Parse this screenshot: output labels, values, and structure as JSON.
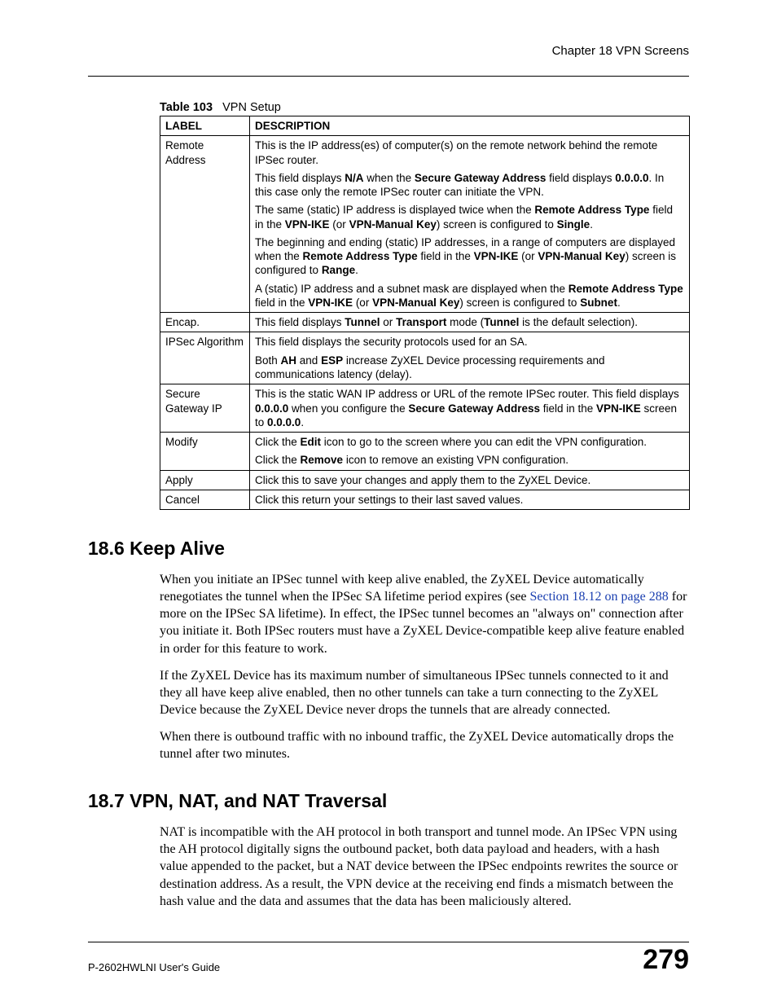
{
  "running_head": "Chapter 18 VPN Screens",
  "table": {
    "caption_num": "Table 103",
    "caption_title": "VPN Setup",
    "head_label": "LABEL",
    "head_desc": "DESCRIPTION",
    "rows": {
      "remote_address": {
        "label": "Remote Address",
        "p1a": "This is the IP address(es) of computer(s) on the remote network behind the remote IPSec router.",
        "p2a": "This field displays ",
        "p2b": "N/A",
        "p2c": " when the ",
        "p2d": "Secure Gateway Address",
        "p2e": " field displays ",
        "p2f": "0.0.0.0",
        "p2g": ". In this case only the remote IPSec router can initiate the VPN.",
        "p3a": "The same (static) IP address is displayed twice when the ",
        "p3b": "Remote Address Type",
        "p3c": " field in the ",
        "p3d": "VPN-IKE",
        "p3e": " (or ",
        "p3f": "VPN-Manual Key",
        "p3g": ") screen is configured to ",
        "p3h": "Single",
        "p3i": ".",
        "p4a": "The beginning and ending (static) IP addresses, in a range of computers are displayed when the ",
        "p4b": "Remote Address Type",
        "p4c": " field in the ",
        "p4d": "VPN-IKE",
        "p4e": " (or ",
        "p4f": "VPN-Manual Key",
        "p4g": ") screen is configured to ",
        "p4h": "Range",
        "p4i": ".",
        "p5a": "A (static) IP address and a subnet mask are displayed when the ",
        "p5b": "Remote Address Type",
        "p5c": " field in the ",
        "p5d": "VPN-IKE",
        "p5e": " (or ",
        "p5f": "VPN-Manual Key",
        "p5g": ") screen is configured to ",
        "p5h": "Subnet",
        "p5i": "."
      },
      "encap": {
        "label": "Encap.",
        "a": "This field displays ",
        "b": "Tunnel",
        "c": " or ",
        "d": "Transport",
        "e": " mode (",
        "f": "Tunnel",
        "g": " is the default selection)."
      },
      "ipsec_alg": {
        "label": "IPSec Algorithm",
        "p1": "This field displays the security protocols used for an SA.",
        "p2a": "Both ",
        "p2b": "AH",
        "p2c": " and ",
        "p2d": "ESP",
        "p2e": " increase ZyXEL Device processing requirements and communications latency (delay)."
      },
      "secure_gw": {
        "label": "Secure Gateway IP",
        "a": "This is the static WAN IP address or URL of the remote IPSec router. This field displays ",
        "b": "0.0.0.0",
        "c": " when you configure the ",
        "d": "Secure Gateway Address",
        "e": " field in the ",
        "f": "VPN-IKE",
        "g": " screen to ",
        "h": "0.0.0.0",
        "i": "."
      },
      "modify": {
        "label": "Modify",
        "p1a": "Click the ",
        "p1b": "Edit",
        "p1c": " icon to go to the screen where you can edit the VPN configuration.",
        "p2a": "Click the ",
        "p2b": "Remove",
        "p2c": " icon to remove an existing VPN configuration."
      },
      "apply": {
        "label": "Apply",
        "a": "Click this to save your changes and apply them to the ZyXEL Device."
      },
      "cancel": {
        "label": "Cancel",
        "a": "Click this return your settings to their last saved values."
      }
    }
  },
  "sections": {
    "keep_alive": {
      "heading": "18.6  Keep Alive",
      "p1a": "When you initiate an IPSec tunnel with keep alive enabled, the ZyXEL Device automatically renegotiates the tunnel when the IPSec SA lifetime period expires (see ",
      "p1link": "Section 18.12 on page 288",
      "p1b": " for more on the IPSec SA lifetime). In effect, the IPSec tunnel becomes an \"always on\" connection after you initiate it. Both IPSec routers must have a ZyXEL Device-compatible keep alive feature enabled in order for this feature to work.",
      "p2": "If the ZyXEL Device has its maximum number of simultaneous IPSec tunnels connected to it and they all have keep alive enabled, then no other tunnels can take a turn connecting to the ZyXEL Device because the ZyXEL Device never drops the tunnels that are already connected.",
      "p3": "When there is outbound traffic with no inbound traffic, the ZyXEL Device automatically drops the tunnel after two minutes."
    },
    "vpn_nat": {
      "heading": "18.7  VPN, NAT, and NAT Traversal",
      "p1": "NAT is incompatible with the AH protocol in both transport and tunnel mode. An IPSec VPN using the AH protocol digitally signs the outbound packet, both data payload and headers, with a hash value appended to the packet, but a NAT device between the IPSec endpoints rewrites the source or destination address. As a result, the VPN device at the receiving end finds a mismatch between the hash value and the data and assumes that the data has been maliciously altered."
    }
  },
  "footer": {
    "guide": "P-2602HWLNI User's Guide",
    "page": "279"
  }
}
